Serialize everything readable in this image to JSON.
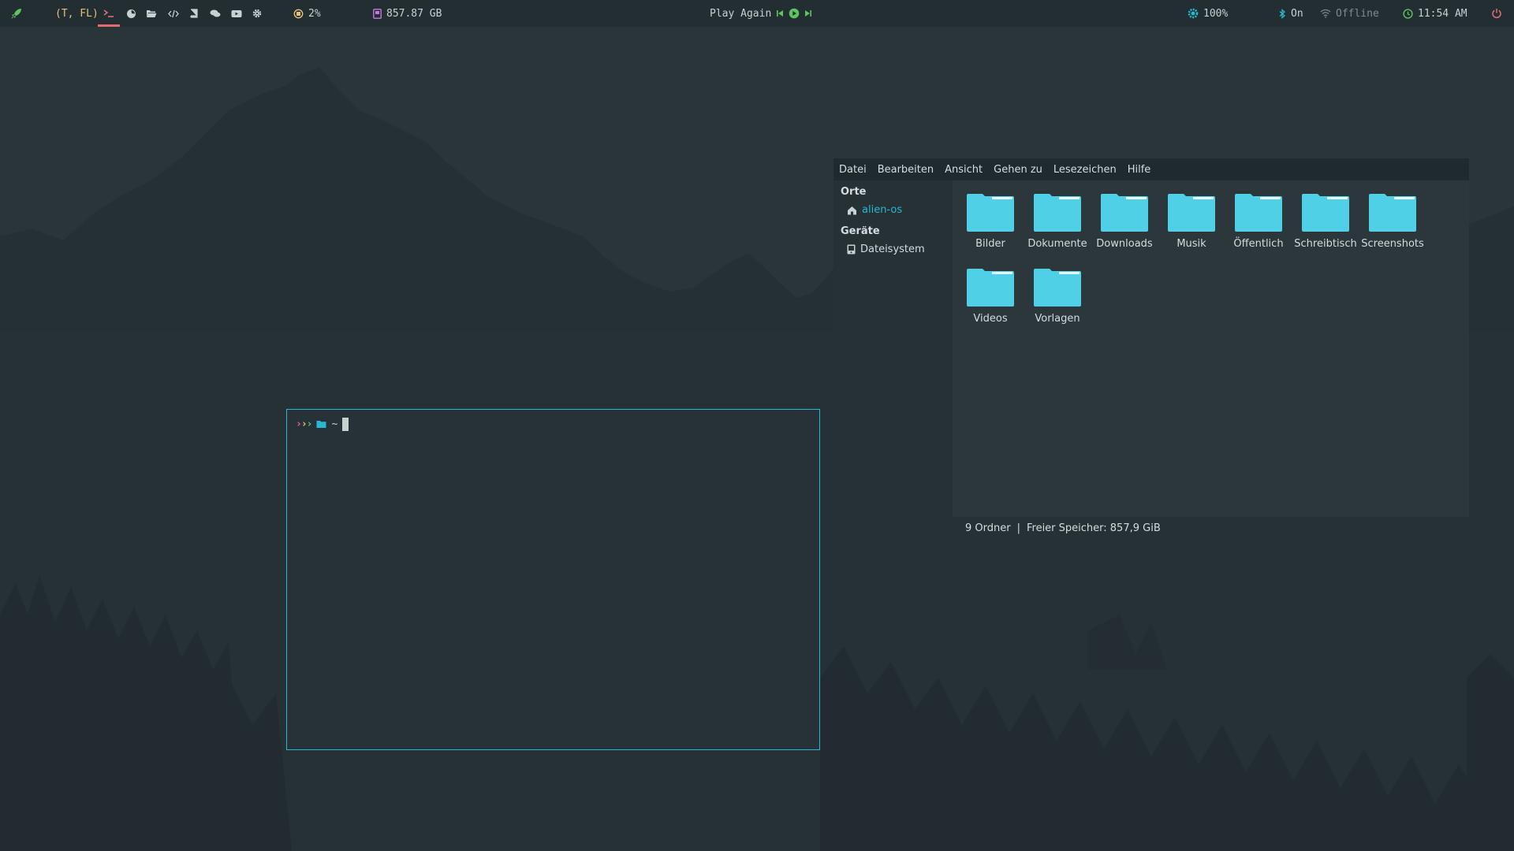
{
  "topbar": {
    "layout_label": "(T, FL)",
    "workspace_icons": [
      "terminal-icon",
      "firefox-icon",
      "folder-open-icon",
      "code-icon",
      "book-icon",
      "chat-icon",
      "youtube-icon",
      "settings-icon"
    ],
    "cpu_value": "2%",
    "disk_value": "857.87 GB",
    "media_title": "Play Again",
    "brightness_value": "100%",
    "bluetooth_value": "On",
    "wifi_value": "Offline",
    "clock_value": "11:54 AM"
  },
  "terminal": {
    "prompt_chevrons": "›››",
    "path": "~"
  },
  "filemanager": {
    "menu": [
      "Datei",
      "Bearbeiten",
      "Ansicht",
      "Gehen zu",
      "Lesezeichen",
      "Hilfe"
    ],
    "sidebar": {
      "places_heading": "Orte",
      "places": [
        {
          "label": "alien-os",
          "icon": "home-icon"
        }
      ],
      "devices_heading": "Geräte",
      "devices": [
        {
          "label": "Dateisystem",
          "icon": "drive-icon"
        }
      ]
    },
    "folders": [
      "Bilder",
      "Dokumente",
      "Downloads",
      "Musik",
      "Öffentlich",
      "Schreibtisch",
      "Screenshots",
      "Videos",
      "Vorlagen"
    ],
    "status": {
      "count": "9 Ordner",
      "divider": "|",
      "free": "Freier Speicher: 857,9 GiB"
    }
  },
  "colors": {
    "accent_cyan": "#28b8d0",
    "folder_cyan": "#4fd0e6",
    "green": "#5ec45e",
    "red": "#e06c75",
    "yellow": "#e5c07b",
    "orange": "#d19a66",
    "magenta": "#c678dd"
  }
}
